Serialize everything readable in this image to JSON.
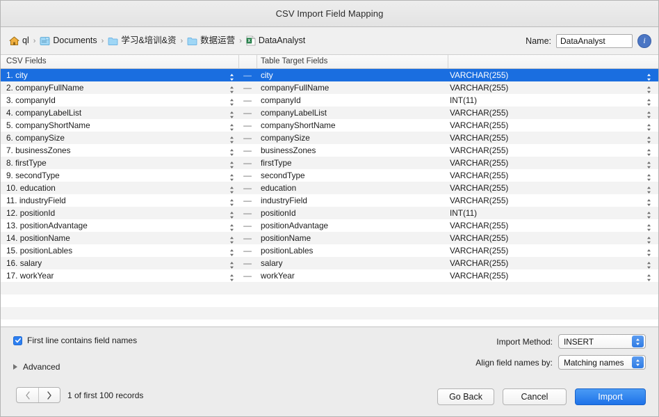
{
  "window": {
    "title": "CSV Import Field Mapping"
  },
  "pathbar": {
    "crumbs": [
      {
        "icon": "home-icon",
        "label": "ql"
      },
      {
        "icon": "folder-doc-icon",
        "label": "Documents"
      },
      {
        "icon": "folder-icon",
        "label": "学习&培训&资"
      },
      {
        "icon": "folder-icon",
        "label": "数据运营"
      },
      {
        "icon": "excel-file-icon",
        "label": "DataAnalyst"
      }
    ],
    "separator": "›",
    "name_label": "Name:",
    "name_value": "DataAnalyst",
    "name_placeholder": "Name",
    "info_glyph": "i"
  },
  "columns": {
    "csv_fields": "CSV Fields",
    "table_target_fields": "Table Target Fields",
    "type_header": ""
  },
  "mapping": {
    "dash": "—",
    "rows": [
      {
        "index": "1.",
        "source": "city",
        "target": "city",
        "type": "VARCHAR(255)",
        "selected": true
      },
      {
        "index": "2.",
        "source": "companyFullName",
        "target": "companyFullName",
        "type": "VARCHAR(255)",
        "selected": false
      },
      {
        "index": "3.",
        "source": "companyId",
        "target": "companyId",
        "type": "INT(11)",
        "selected": false
      },
      {
        "index": "4.",
        "source": "companyLabelList",
        "target": "companyLabelList",
        "type": "VARCHAR(255)",
        "selected": false
      },
      {
        "index": "5.",
        "source": "companyShortName",
        "target": "companyShortName",
        "type": "VARCHAR(255)",
        "selected": false
      },
      {
        "index": "6.",
        "source": "companySize",
        "target": "companySize",
        "type": "VARCHAR(255)",
        "selected": false
      },
      {
        "index": "7.",
        "source": "businessZones",
        "target": "businessZones",
        "type": "VARCHAR(255)",
        "selected": false
      },
      {
        "index": "8.",
        "source": "firstType",
        "target": "firstType",
        "type": "VARCHAR(255)",
        "selected": false
      },
      {
        "index": "9.",
        "source": "secondType",
        "target": "secondType",
        "type": "VARCHAR(255)",
        "selected": false
      },
      {
        "index": "10.",
        "source": "education",
        "target": "education",
        "type": "VARCHAR(255)",
        "selected": false
      },
      {
        "index": "11.",
        "source": "industryField",
        "target": "industryField",
        "type": "VARCHAR(255)",
        "selected": false
      },
      {
        "index": "12.",
        "source": "positionId",
        "target": "positionId",
        "type": "INT(11)",
        "selected": false
      },
      {
        "index": "13.",
        "source": "positionAdvantage",
        "target": "positionAdvantage",
        "type": "VARCHAR(255)",
        "selected": false
      },
      {
        "index": "14.",
        "source": "positionName",
        "target": "positionName",
        "type": "VARCHAR(255)",
        "selected": false
      },
      {
        "index": "15.",
        "source": "positionLables",
        "target": "positionLables",
        "type": "VARCHAR(255)",
        "selected": false
      },
      {
        "index": "16.",
        "source": "salary",
        "target": "salary",
        "type": "VARCHAR(255)",
        "selected": false
      },
      {
        "index": "17.",
        "source": "workYear",
        "target": "workYear",
        "type": "VARCHAR(255)",
        "selected": false
      }
    ]
  },
  "options": {
    "first_line_checkbox_label": "First line contains field names",
    "first_line_checked": true,
    "advanced_label": "Advanced",
    "advanced_expanded": false,
    "import_method_label": "Import Method:",
    "import_method_value": "INSERT",
    "align_label": "Align field names by:",
    "align_value": "Matching names",
    "records_text": "1 of first 100 records"
  },
  "footer": {
    "go_back": "Go Back",
    "cancel": "Cancel",
    "import": "Import"
  },
  "colors": {
    "selection_blue": "#1a6ee0",
    "primary_button": "#2f7be4",
    "window_chrome": "#ececec",
    "row_alt": "#f3f3f3"
  }
}
